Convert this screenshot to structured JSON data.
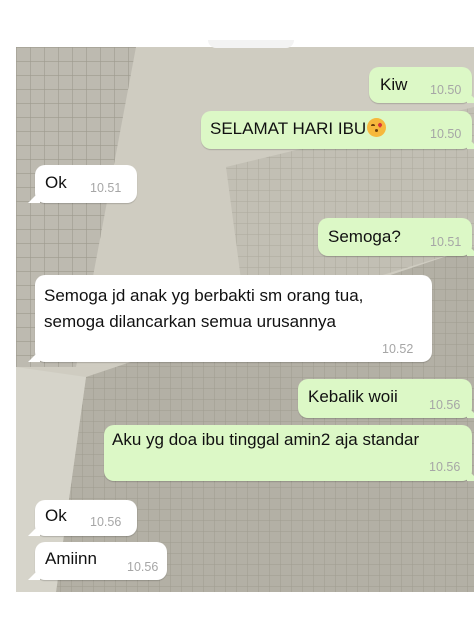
{
  "messages": [
    {
      "id": "m1",
      "side": "out",
      "text": "Kiw",
      "time": "10.50"
    },
    {
      "id": "m2",
      "side": "out",
      "text": "SELAMAT HARI IBU",
      "emoji": "face-blowing-a-kiss",
      "time": "10.50"
    },
    {
      "id": "m3",
      "side": "in",
      "text": "Ok",
      "time": "10.51"
    },
    {
      "id": "m4",
      "side": "out",
      "text": "Semoga?",
      "time": "10.51"
    },
    {
      "id": "m5",
      "side": "in",
      "lines": [
        "Semoga jd anak yg berbakti sm orang tua,",
        "semoga dilancarkan semua urusannya"
      ],
      "time": "10.52"
    },
    {
      "id": "m6",
      "side": "out",
      "text": "Kebalik woii",
      "time": "10.56"
    },
    {
      "id": "m7",
      "side": "out",
      "text": "Aku yg doa ibu tinggal amin2 aja standar",
      "time": "10.56"
    },
    {
      "id": "m8",
      "side": "in",
      "text": "Ok",
      "time": "10.56"
    },
    {
      "id": "m9",
      "side": "in",
      "text": "Amiinn",
      "time": "10.56"
    }
  ],
  "colors": {
    "incoming_bubble": "#ffffff",
    "outgoing_bubble": "#dcf8c6",
    "timestamp": "#a6a6a6",
    "wallpaper": "#c9c7bc"
  }
}
